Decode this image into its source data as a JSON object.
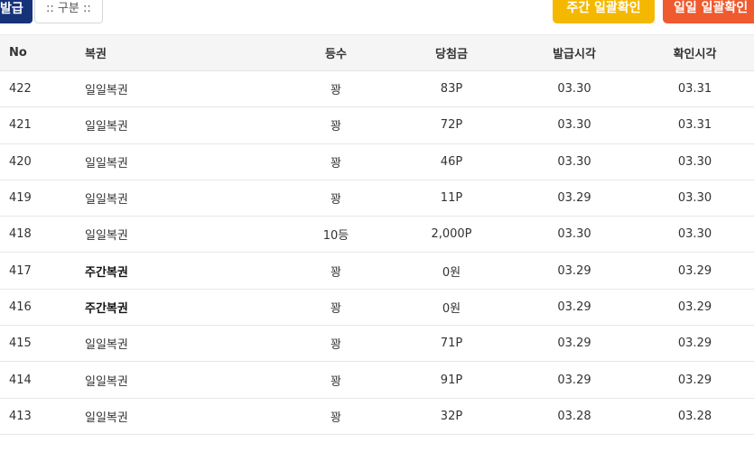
{
  "toolbar": {
    "issue_label": "발급",
    "filter_label": ":: 구분 ::",
    "weekly_confirm_label": "주간 일괄확인",
    "daily_confirm_label": "일일 일괄확인"
  },
  "table": {
    "headers": [
      "No",
      "복권",
      "등수",
      "당첨금",
      "발급시각",
      "확인시각"
    ],
    "rows": [
      {
        "no": "422",
        "name": "일일복권",
        "rank": "꽝",
        "prize": "83P",
        "issued": "03.30",
        "checked": "03.31",
        "bold": false
      },
      {
        "no": "421",
        "name": "일일복권",
        "rank": "꽝",
        "prize": "72P",
        "issued": "03.30",
        "checked": "03.31",
        "bold": false
      },
      {
        "no": "420",
        "name": "일일복권",
        "rank": "꽝",
        "prize": "46P",
        "issued": "03.30",
        "checked": "03.30",
        "bold": false
      },
      {
        "no": "419",
        "name": "일일복권",
        "rank": "꽝",
        "prize": "11P",
        "issued": "03.29",
        "checked": "03.30",
        "bold": false
      },
      {
        "no": "418",
        "name": "일일복권",
        "rank": "10등",
        "prize": "2,000P",
        "issued": "03.30",
        "checked": "03.30",
        "bold": false
      },
      {
        "no": "417",
        "name": "주간복권",
        "rank": "꽝",
        "prize": "0원",
        "issued": "03.29",
        "checked": "03.29",
        "bold": true
      },
      {
        "no": "416",
        "name": "주간복권",
        "rank": "꽝",
        "prize": "0원",
        "issued": "03.29",
        "checked": "03.29",
        "bold": true
      },
      {
        "no": "415",
        "name": "일일복권",
        "rank": "꽝",
        "prize": "71P",
        "issued": "03.29",
        "checked": "03.29",
        "bold": false
      },
      {
        "no": "414",
        "name": "일일복권",
        "rank": "꽝",
        "prize": "91P",
        "issued": "03.29",
        "checked": "03.29",
        "bold": false
      },
      {
        "no": "413",
        "name": "일일복권",
        "rank": "꽝",
        "prize": "32P",
        "issued": "03.28",
        "checked": "03.28",
        "bold": false
      }
    ]
  }
}
